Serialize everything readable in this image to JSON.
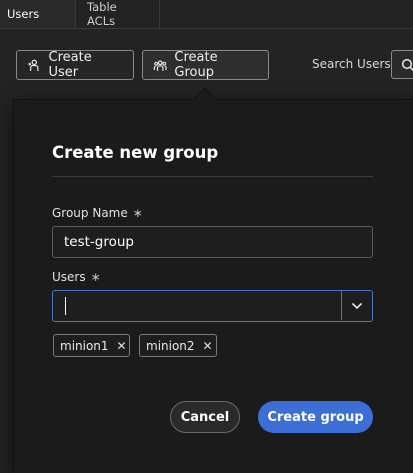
{
  "tabs": [
    {
      "label": "Users",
      "active": true
    },
    {
      "label": "Table ACLs",
      "active": false
    }
  ],
  "toolbar": {
    "create_user_label": "Create User",
    "create_group_label": "Create Group",
    "search_label": "Search Users"
  },
  "dialog": {
    "title": "Create new group",
    "group_name_label": "Group Name",
    "group_name_value": "test-group",
    "users_label": "Users",
    "required_mark": "∗",
    "users_input_value": "",
    "selected_users": [
      "minion1",
      "minion2"
    ],
    "remove_glyph": "✕",
    "cancel_label": "Cancel",
    "submit_label": "Create group"
  },
  "colors": {
    "accent": "#3b6fd6",
    "focus_border": "#4a77c9",
    "background": "#232323",
    "popover_background": "#1b1b1b"
  },
  "icons": {
    "create_user": "user-plus-icon",
    "create_group": "group-icon",
    "search": "search-icon",
    "dropdown": "chevron-down-icon",
    "remove": "close-icon"
  }
}
